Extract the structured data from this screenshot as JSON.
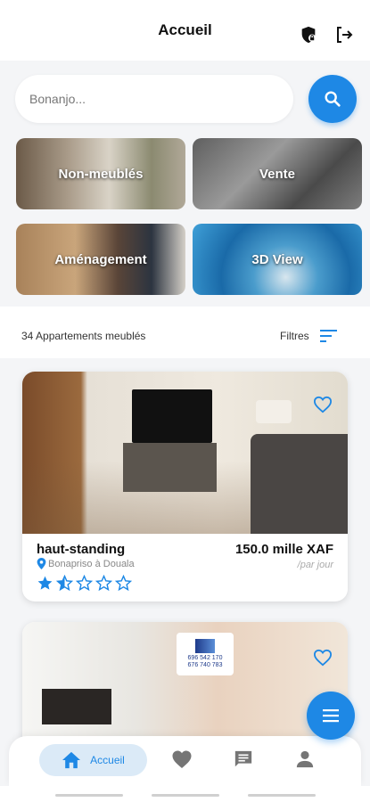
{
  "header": {
    "title": "Accueil",
    "icons": [
      "shield-lock-icon",
      "logout-icon"
    ]
  },
  "search": {
    "placeholder": "Bonanjo...",
    "value": "",
    "button_icon": "search-icon"
  },
  "categories": [
    {
      "label": "Non-meublés"
    },
    {
      "label": "Vente"
    },
    {
      "label": "Aménagement"
    },
    {
      "label": "3D View"
    }
  ],
  "results": {
    "count_text": "34 Appartements meublés",
    "filter_label": "Filtres",
    "filter_icon": "sort-icon"
  },
  "listings": [
    {
      "name": "haut-standing",
      "location": "Bonapriso à Douala",
      "price": "150.0 mille XAF",
      "period": "/par jour",
      "rating": 1.5,
      "rating_max": 5,
      "favorite": false
    },
    {
      "logo_line1": "696 542 170",
      "logo_line2": "676 740 783",
      "favorite": false
    }
  ],
  "bottom_nav": {
    "items": [
      "Accueil",
      "favorites",
      "messages",
      "profile"
    ],
    "active_label": "Accueil"
  },
  "colors": {
    "accent": "#1e88e5",
    "accent_light": "#dbeaf7",
    "text": "#111111",
    "muted": "#888888"
  }
}
